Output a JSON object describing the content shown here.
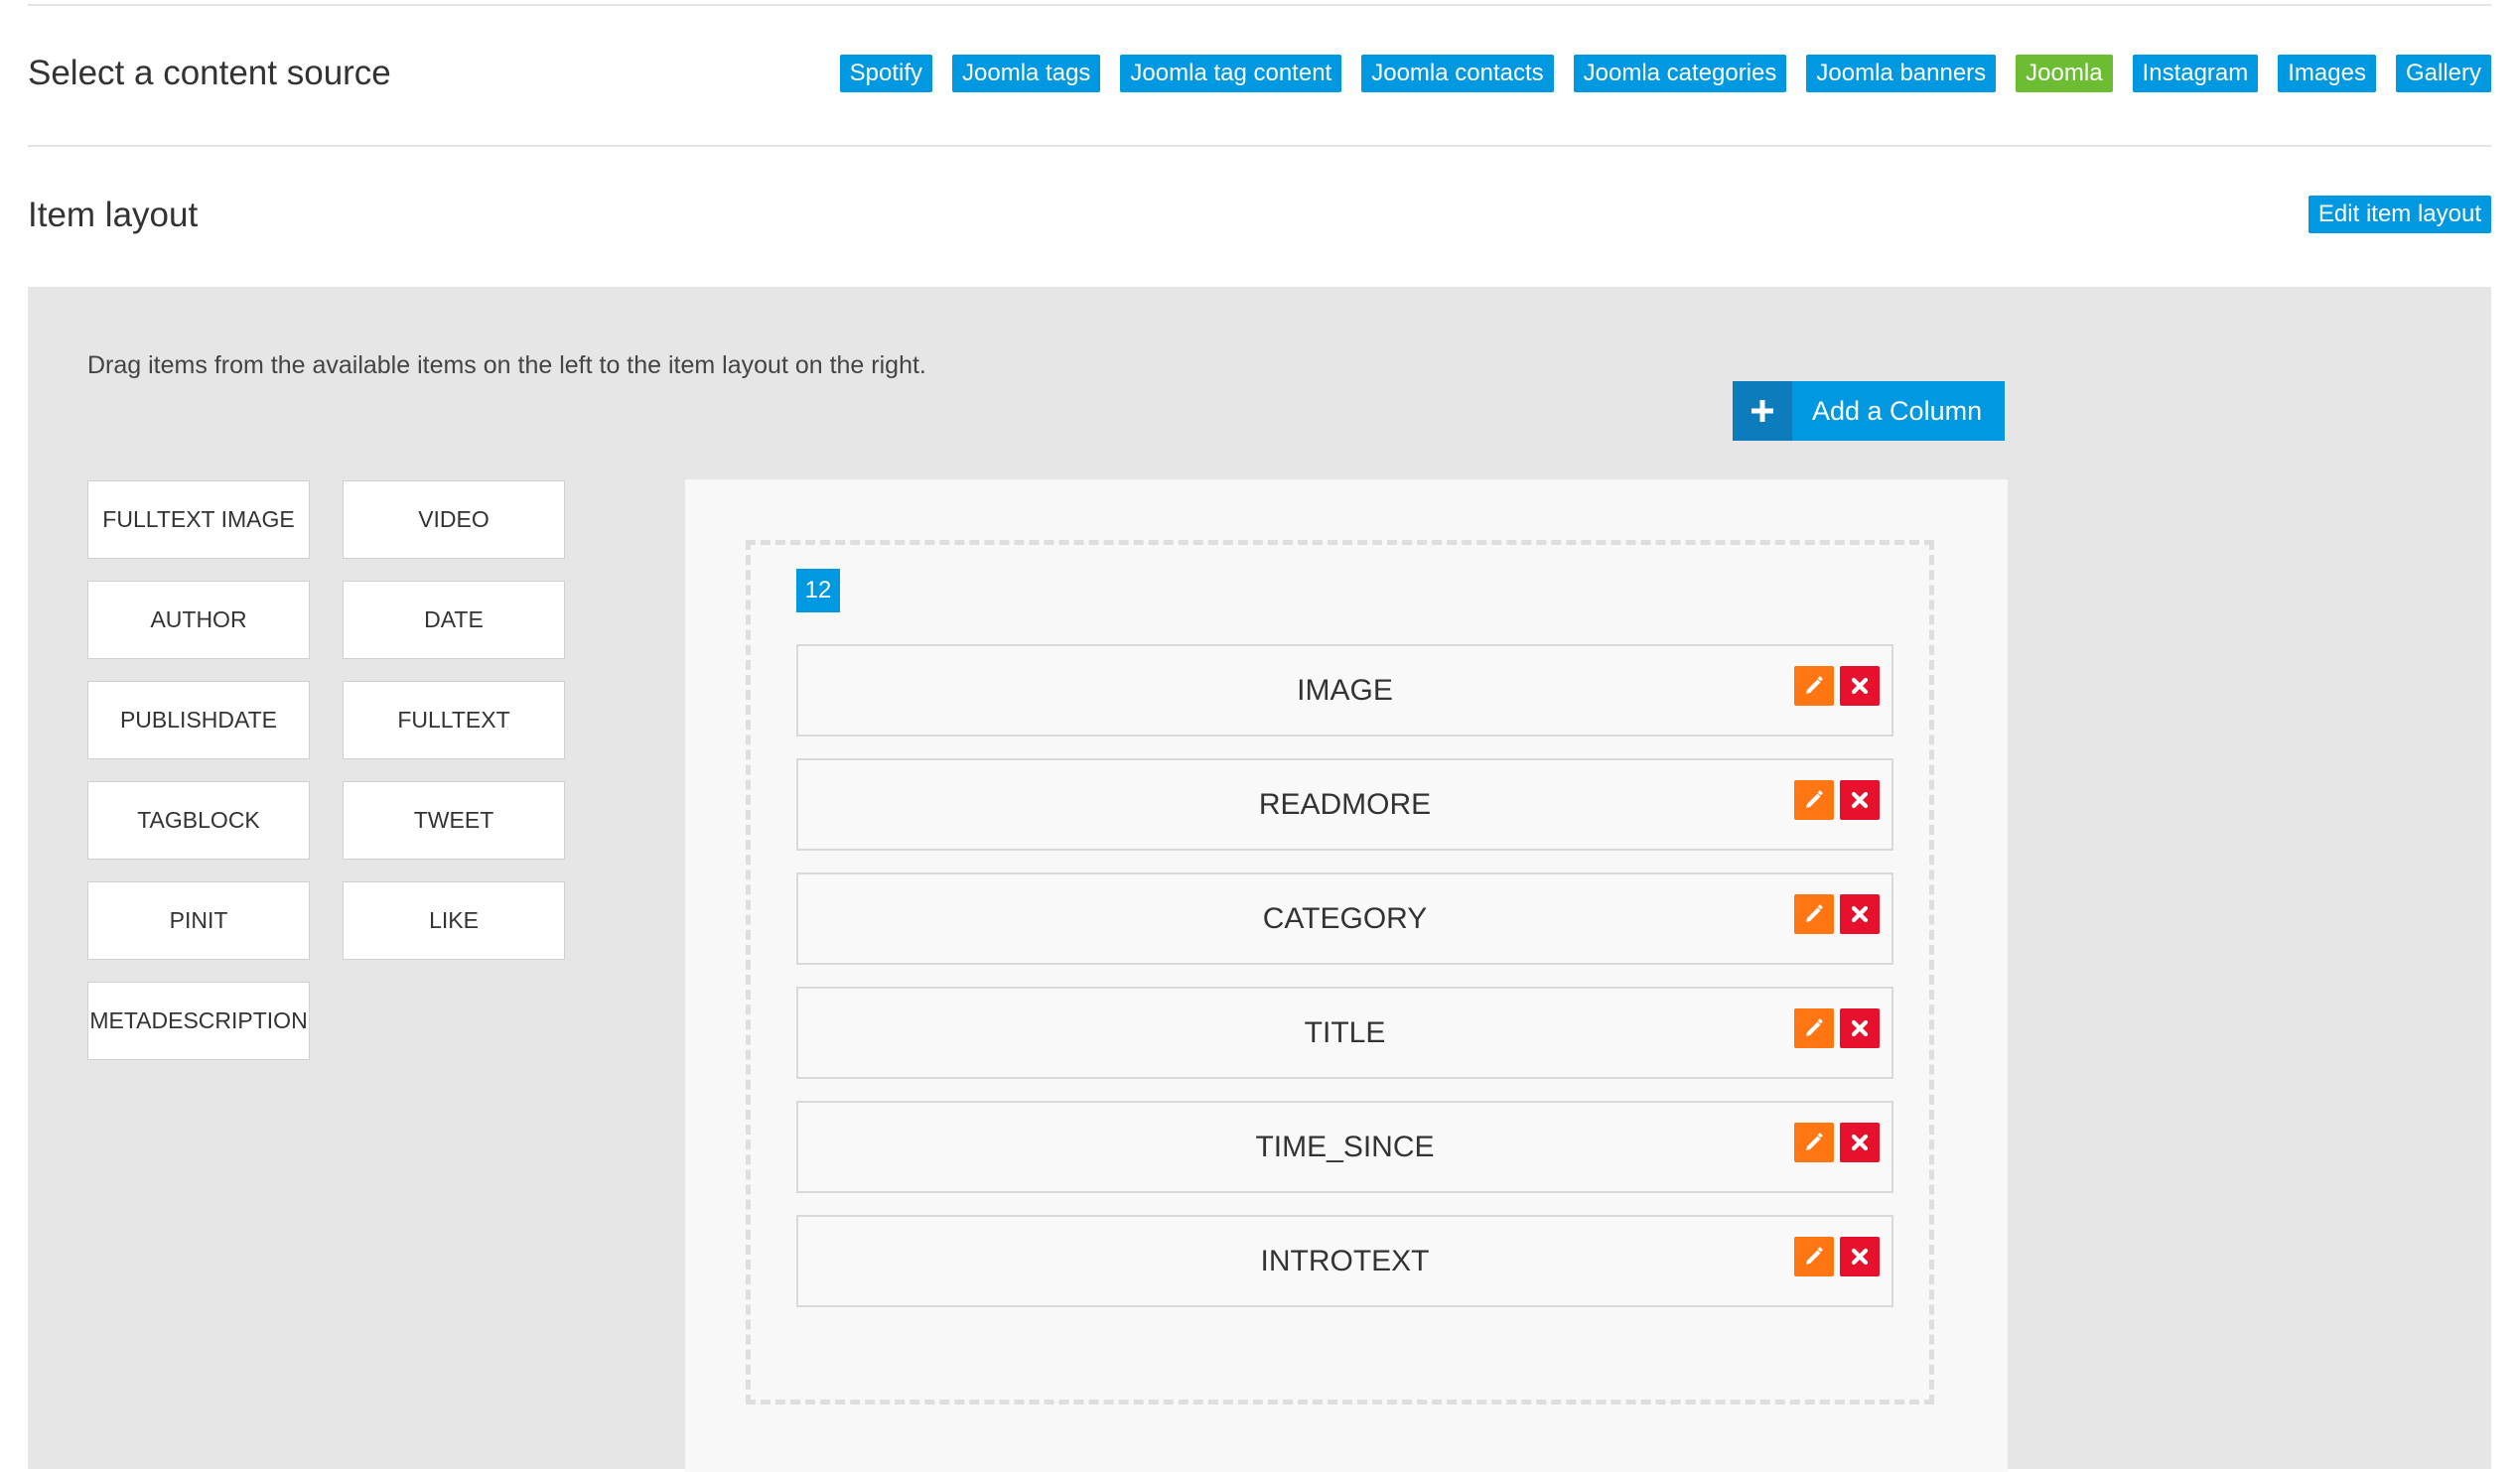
{
  "colors": {
    "primary": "#0098e0",
    "primary_dark": "#0d7cbd",
    "active": "#6cbd32",
    "edit": "#ff7612",
    "remove": "#e8112d"
  },
  "content_source": {
    "title": "Select a content source",
    "sources": [
      {
        "label": "Spotify",
        "active": false
      },
      {
        "label": "Joomla tags",
        "active": false
      },
      {
        "label": "Joomla tag content",
        "active": false
      },
      {
        "label": "Joomla contacts",
        "active": false
      },
      {
        "label": "Joomla categories",
        "active": false
      },
      {
        "label": "Joomla banners",
        "active": false
      },
      {
        "label": "Joomla",
        "active": true
      },
      {
        "label": "Instagram",
        "active": false
      },
      {
        "label": "Images",
        "active": false
      },
      {
        "label": "Gallery",
        "active": false
      }
    ]
  },
  "item_layout": {
    "title": "Item layout",
    "edit_button": "Edit item layout",
    "help_text": "Drag items from the available items on the left to the item layout on the right.",
    "add_column": {
      "icon": "plus-icon",
      "label": "Add a Column"
    }
  },
  "available_items": [
    "FULLTEXT IMAGE",
    "VIDEO",
    "AUTHOR",
    "DATE",
    "PUBLISHDATE",
    "FULLTEXT",
    "TAGBLOCK",
    "TWEET",
    "PINIT",
    "LIKE",
    "METADESCRIPTION"
  ],
  "column": {
    "size": "12",
    "items": [
      {
        "label": "IMAGE",
        "edit_icon": "pencil-icon",
        "remove_icon": "close-icon"
      },
      {
        "label": "READMORE",
        "edit_icon": "pencil-icon",
        "remove_icon": "close-icon"
      },
      {
        "label": "CATEGORY",
        "edit_icon": "pencil-icon",
        "remove_icon": "close-icon"
      },
      {
        "label": "TITLE",
        "edit_icon": "pencil-icon",
        "remove_icon": "close-icon"
      },
      {
        "label": "TIME_SINCE",
        "edit_icon": "pencil-icon",
        "remove_icon": "close-icon"
      },
      {
        "label": "INTROTEXT",
        "edit_icon": "pencil-icon",
        "remove_icon": "close-icon"
      }
    ]
  }
}
